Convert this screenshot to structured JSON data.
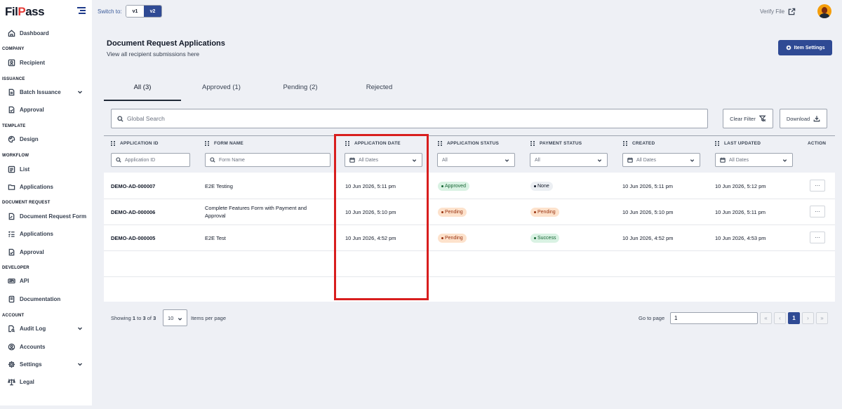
{
  "brand": {
    "logo": "FilPass"
  },
  "sidebar": {
    "items": [
      {
        "label": "Dashboard",
        "icon": "home-icon"
      },
      {
        "section": "COMPANY"
      },
      {
        "label": "Recipient",
        "icon": "user-card-icon"
      },
      {
        "section": "ISSUANCE"
      },
      {
        "label": "Batch Issuance",
        "icon": "document-stack-icon",
        "expandable": true
      },
      {
        "label": "Approval",
        "icon": "document-check-icon"
      },
      {
        "section": "TEMPLATE"
      },
      {
        "label": "Design",
        "icon": "palette-icon"
      },
      {
        "section": "WORKFLOW"
      },
      {
        "label": "List",
        "icon": "list-icon"
      },
      {
        "label": "Applications",
        "icon": "folder-icon"
      },
      {
        "section": "DOCUMENT REQUEST"
      },
      {
        "label": "Document Request Form",
        "icon": "document-edit-icon"
      },
      {
        "label": "Applications",
        "icon": "checklist-icon"
      },
      {
        "label": "Approval",
        "icon": "document-check-icon"
      },
      {
        "section": "DEVELOPER"
      },
      {
        "label": "API",
        "icon": "api-icon"
      },
      {
        "label": "Documentation",
        "icon": "book-icon"
      },
      {
        "section": "ACCOUNT"
      },
      {
        "label": "Audit Log",
        "icon": "document-search-icon",
        "expandable": true
      },
      {
        "label": "Accounts",
        "icon": "user-circle-icon"
      },
      {
        "label": "Settings",
        "icon": "gear-icon",
        "expandable": true
      },
      {
        "label": "Legal",
        "icon": "scale-icon"
      }
    ]
  },
  "topbar": {
    "switch_label": "Switch to:",
    "versions": [
      "v1",
      "v2"
    ],
    "active_version": "v2",
    "verify_file": "Verify File"
  },
  "header": {
    "title": "Document Request Applications",
    "subtitle": "View all recipient submissions here",
    "item_settings": "Item Settings"
  },
  "tabs": [
    "All (3)",
    "Approved (1)",
    "Pending (2)",
    "Rejected"
  ],
  "active_tab": "All (3)",
  "toolbar": {
    "search_placeholder": "Global Search",
    "clear_filter": "Clear Filter",
    "download": "Download"
  },
  "table": {
    "columns": [
      "APPLICATION ID",
      "FORM NAME",
      "APPLICATION DATE",
      "APPLICATION STATUS",
      "PAYMENT STATUS",
      "CREATED",
      "LAST UPDATED",
      "ACTION"
    ],
    "filters": {
      "application_id": "Application ID",
      "form_name": "Form Name",
      "application_date": "All Dates",
      "application_status": "All",
      "payment_status": "All",
      "created": "All Dates",
      "last_updated": "All Dates"
    },
    "rows": [
      {
        "id": "DEMO-AD-000007",
        "form": "E2E Testing",
        "app_date": "10 Jun 2026, 5:11 pm",
        "app_status": "Approved",
        "payment": "None",
        "created": "10 Jun 2026, 5:11 pm",
        "updated": "10 Jun 2026, 5:12 pm",
        "action": "···"
      },
      {
        "id": "DEMO-AD-000006",
        "form": "Complete Features Form with Payment and Approval",
        "app_date": "10 Jun 2026, 5:10 pm",
        "app_status": "Pending",
        "payment": "Pending",
        "created": "10 Jun 2026, 5:10 pm",
        "updated": "10 Jun 2026, 5:11 pm",
        "action": "···"
      },
      {
        "id": "DEMO-AD-000005",
        "form": "E2E Test",
        "app_date": "10 Jun 2026, 4:52 pm",
        "app_status": "Pending",
        "payment": "Success",
        "created": "10 Jun 2026, 4:52 pm",
        "updated": "10 Jun 2026, 4:53 pm",
        "action": "···"
      }
    ]
  },
  "pagination": {
    "showing_prefix": "Showing ",
    "from": "1",
    "to_word": " to ",
    "to": "3",
    "of_word": " of ",
    "total": "3",
    "per_page": "10",
    "per_page_label": "Items per page",
    "goto_label": "Go to page",
    "goto_value": "1",
    "first": "«",
    "prev": "‹",
    "current": "1",
    "next": "›",
    "last": "»"
  },
  "colors": {
    "primary": "#2f4a94",
    "highlight": "#d81e1e",
    "approved_bg": "#d9f2e3",
    "pending_bg": "#fde2cc"
  }
}
